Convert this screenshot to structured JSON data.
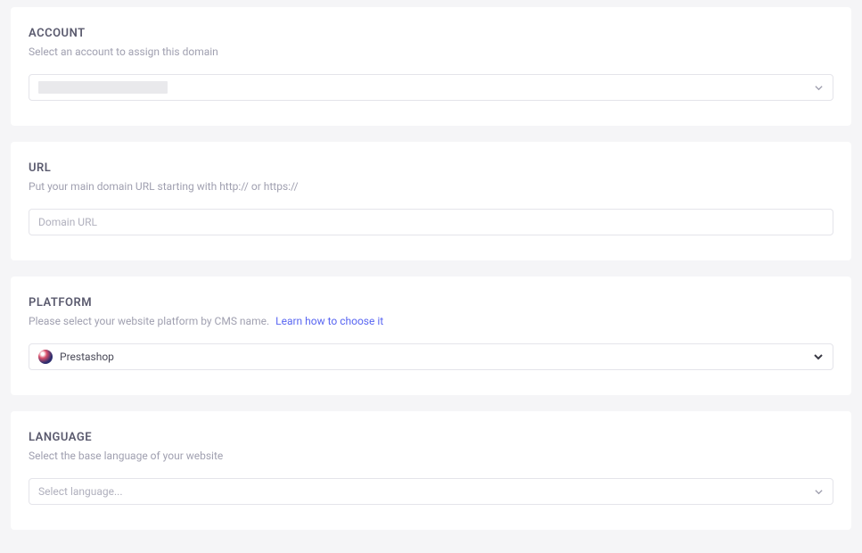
{
  "sections": {
    "account": {
      "title": "ACCOUNT",
      "description": "Select an account to assign this domain",
      "selected_value": ""
    },
    "url": {
      "title": "URL",
      "description": "Put your main domain URL starting with http:// or https://",
      "placeholder": "Domain URL"
    },
    "platform": {
      "title": "PLATFORM",
      "description": "Please select your website platform by CMS name.",
      "learn_link": "Learn how to choose it",
      "selected_value": "Prestashop"
    },
    "language": {
      "title": "LANGUAGE",
      "description": "Select the base language of your website",
      "placeholder": "Select language..."
    }
  }
}
